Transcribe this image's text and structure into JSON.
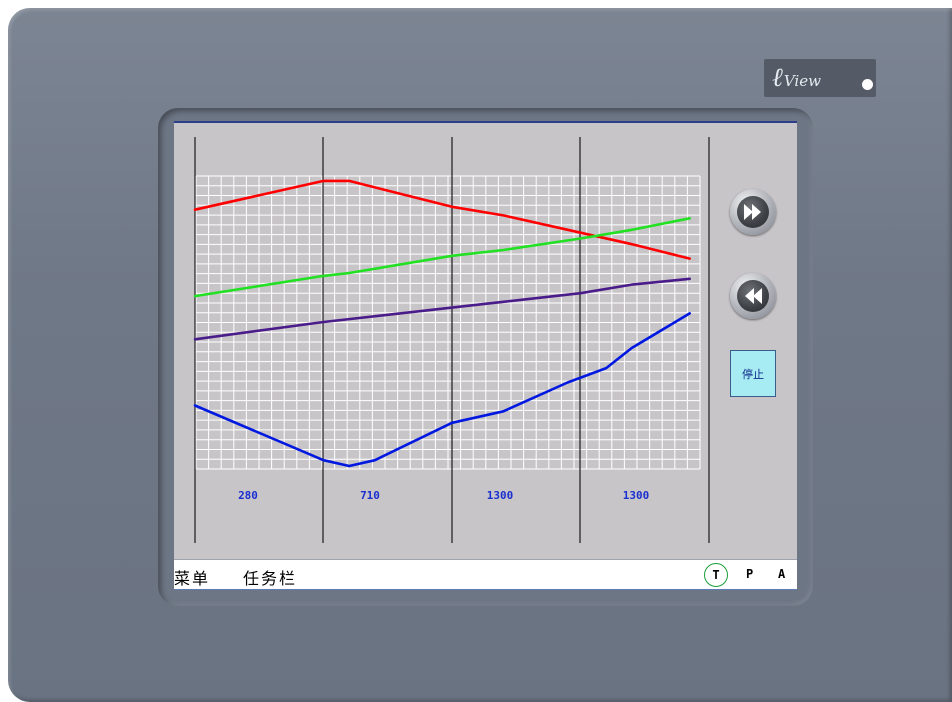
{
  "brand": {
    "logo_mark": "ℓ",
    "logo_text": "View",
    "led_color": "#ffffff"
  },
  "chart_data": {
    "type": "line",
    "grid": true,
    "series": [
      {
        "color": "#ff0000",
        "values": [
          [
            0,
            0.89
          ],
          [
            1.0,
            0.99
          ],
          [
            1.2,
            0.99
          ],
          [
            2.0,
            0.9
          ],
          [
            2.4,
            0.87
          ],
          [
            3.0,
            0.81
          ],
          [
            3.4,
            0.77
          ],
          [
            3.85,
            0.72
          ]
        ]
      },
      {
        "color": "#22e022",
        "values": [
          [
            0,
            0.59
          ],
          [
            1.0,
            0.66
          ],
          [
            1.2,
            0.67
          ],
          [
            2.0,
            0.73
          ],
          [
            2.4,
            0.75
          ],
          [
            3.0,
            0.79
          ],
          [
            3.4,
            0.82
          ],
          [
            3.85,
            0.86
          ]
        ]
      },
      {
        "color": "#4a1c8a",
        "values": [
          [
            0,
            0.44
          ],
          [
            1.0,
            0.5
          ],
          [
            2.0,
            0.55
          ],
          [
            2.4,
            0.57
          ],
          [
            3.0,
            0.6
          ],
          [
            3.4,
            0.63
          ],
          [
            3.85,
            0.65
          ]
        ]
      },
      {
        "color": "#0018e0",
        "values": [
          [
            0,
            0.21
          ],
          [
            1.0,
            0.02
          ],
          [
            1.2,
            0.0
          ],
          [
            1.4,
            0.02
          ],
          [
            2.0,
            0.15
          ],
          [
            2.4,
            0.19
          ],
          [
            2.9,
            0.29
          ],
          [
            3.2,
            0.34
          ],
          [
            3.4,
            0.41
          ],
          [
            3.85,
            0.53
          ]
        ]
      }
    ],
    "x_tick_labels": [
      "280",
      "710",
      "1300",
      "1300"
    ]
  },
  "controls": {
    "forward_icon": "fast-forward-icon",
    "rewind_icon": "rewind-icon",
    "stop_label": "停止"
  },
  "taskbar": {
    "menu_label": "菜单",
    "task_label": "任务栏",
    "t_label": "T",
    "p_label": "P",
    "a_label": "A",
    "t_ring_color": "#1a9e3a"
  }
}
